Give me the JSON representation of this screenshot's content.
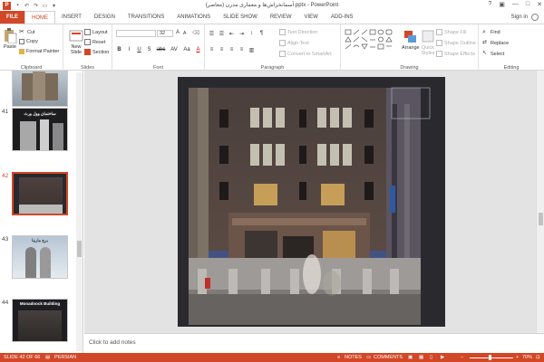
{
  "titlebar": {
    "title": "آسمانخراش‌ها و معماری مدرن (معاصر).pptx - PowerPoint",
    "minimize": "—",
    "maximize": "□",
    "close": "✕",
    "help": "?"
  },
  "tabs": [
    "FILE",
    "HOME",
    "INSERT",
    "DESIGN",
    "TRANSITIONS",
    "ANIMATIONS",
    "SLIDE SHOW",
    "REVIEW",
    "VIEW",
    "ADD-INS"
  ],
  "active_tab": "HOME",
  "signin": "Sign in",
  "ribbon": {
    "clipboard": {
      "label": "Clipboard",
      "paste": "Paste",
      "cut": "Cut",
      "copy": "Copy",
      "format_painter": "Format Painter"
    },
    "slides": {
      "label": "Slides",
      "new_slide": "New Slide",
      "layout": "Layout",
      "reset": "Reset",
      "section": "Section"
    },
    "font": {
      "label": "Font",
      "size": "32",
      "bold": "B",
      "italic": "I",
      "underline": "U",
      "shadow": "S",
      "strike": "abc",
      "spacing": "AV",
      "case": "Aa",
      "color": "A"
    },
    "paragraph": {
      "label": "Paragraph",
      "text_direction": "Text Direction",
      "align_text": "Align Text",
      "smartart": "Convert to SmartArt"
    },
    "drawing": {
      "label": "Drawing",
      "arrange": "Arrange",
      "quick_styles": "Quick Styles",
      "shape_fill": "Shape Fill",
      "shape_outline": "Shape Outline",
      "shape_effects": "Shape Effects"
    },
    "editing": {
      "label": "Editing",
      "find": "Find",
      "replace": "Replace",
      "select": "Select"
    }
  },
  "thumbnails": [
    {
      "number": "",
      "caption": ""
    },
    {
      "number": "41",
      "caption": "ساختمان وول ورث"
    },
    {
      "number": "42",
      "caption": ""
    },
    {
      "number": "43",
      "caption": "برج مارینا"
    },
    {
      "number": "44",
      "caption": "Monadnock Building"
    }
  ],
  "selected_slide": "42",
  "notes_placeholder": "Click to add notes",
  "status": {
    "slide_info": "SLIDE 42 OF 66",
    "language": "PERSIAN",
    "notes": "NOTES",
    "comments": "COMMENTS",
    "zoom": "70%",
    "minus": "−",
    "plus": "+"
  },
  "colors": {
    "accent": "#d24726"
  }
}
